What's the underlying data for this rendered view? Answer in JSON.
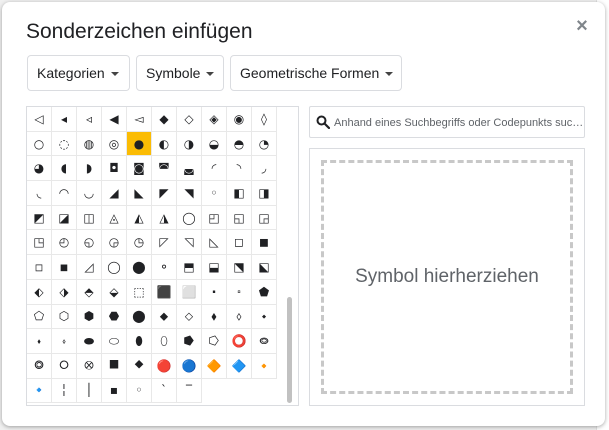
{
  "dialog": {
    "title": "Sonderzeichen einfügen",
    "close": "×"
  },
  "dropdowns": {
    "category": "Kategorien",
    "subcategory": "Symbole",
    "set": "Geometrische Formen"
  },
  "search": {
    "placeholder": "Anhand eines Suchbegriffs oder Codepunkts suc…"
  },
  "drop_zone": {
    "label": "Symbol hierherziehen"
  },
  "grid": {
    "selected_index": 14,
    "symbols": [
      "◁",
      "◂",
      "◃",
      "◀",
      "◅",
      "◆",
      "◇",
      "◈",
      "◉",
      "◊",
      "○",
      "◌",
      "◍",
      "◎",
      "●",
      "◐",
      "◑",
      "◒",
      "◓",
      "◔",
      "◕",
      "◖",
      "◗",
      "◘",
      "◙",
      "◚",
      "◛",
      "◜",
      "◝",
      "◞",
      "◟",
      "◠",
      "◡",
      "◢",
      "◣",
      "◤",
      "◥",
      "◦",
      "◧",
      "◨",
      "◩",
      "◪",
      "◫",
      "◬",
      "◭",
      "◮",
      "◯",
      "◰",
      "◱",
      "◲",
      "◳",
      "◴",
      "◵",
      "◶",
      "◷",
      "◸",
      "◹",
      "◺",
      "◻",
      "◼",
      "◽",
      "◾",
      "◿",
      "◯",
      "⬤",
      "⚬",
      "⬒",
      "⬓",
      "⬔",
      "⬕",
      "⬖",
      "⬗",
      "⬘",
      "⬙",
      "⬚",
      "⬛",
      "⬜",
      "⬝",
      "⬞",
      "⬟",
      "⬠",
      "⬡",
      "⬢",
      "⬣",
      "⬤",
      "⬥",
      "⬦",
      "⬧",
      "⬨",
      "⬩",
      "⬪",
      "⬫",
      "⬬",
      "⬭",
      "⬮",
      "⬯",
      "⭓",
      "⭔",
      "⭕",
      "⭖",
      "⭗",
      "⭘",
      "⭙",
      "⯀",
      "⯁",
      "🔴",
      "🔵",
      "🔶",
      "🔷",
      "🔸",
      "🔹",
      "╎",
      "│",
      "▪",
      "◦",
      "ˋ",
      "‾"
    ]
  },
  "colors": {
    "selected": "#fbbc04",
    "red": "#ea1f25",
    "blue": "#1a73e8",
    "orange": "#f27022"
  }
}
